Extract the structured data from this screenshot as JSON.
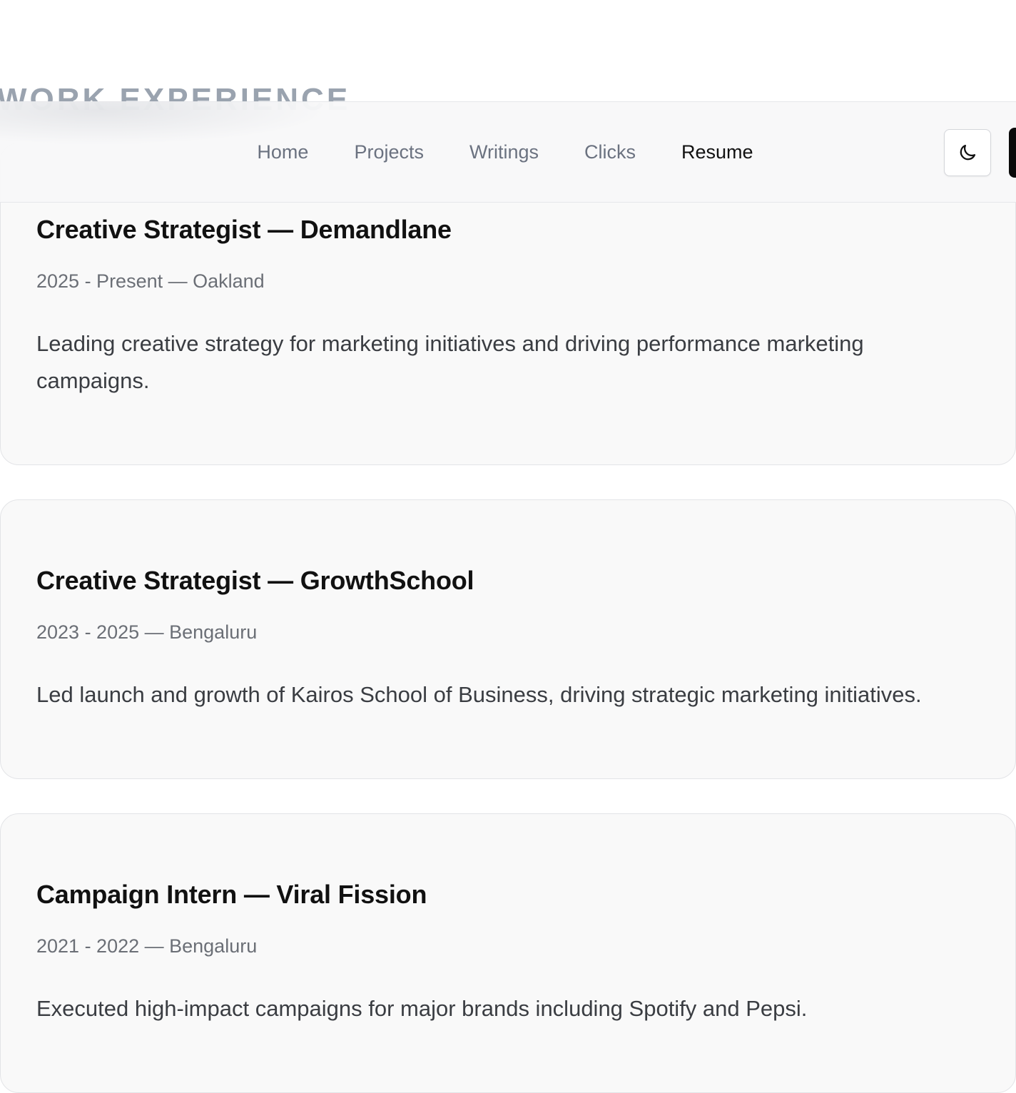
{
  "section": {
    "heading": "WORK EXPERIENCE"
  },
  "nav": {
    "links": [
      {
        "label": "Home"
      },
      {
        "label": "Projects"
      },
      {
        "label": "Writings"
      },
      {
        "label": "Clicks"
      },
      {
        "label": "Resume"
      }
    ],
    "active": "Resume",
    "theme_toggle_icon": "moon-icon"
  },
  "experience": [
    {
      "title": "Creative Strategist — Demandlane",
      "meta": "2025 - Present — Oakland",
      "description": "Leading creative strategy for marketing initiatives and driving performance marketing campaigns."
    },
    {
      "title": "Creative Strategist — GrowthSchool",
      "meta": "2023 - 2025 — Bengaluru",
      "description": "Led launch and growth of Kairos School of Business, driving strategic marketing initiatives."
    },
    {
      "title": "Campaign Intern — Viral Fission",
      "meta": "2021 - 2022 — Bengaluru",
      "description": "Executed high-impact campaigns for major brands including Spotify and Pepsi."
    }
  ],
  "colors": {
    "accent_active": "#111111",
    "nav_inactive": "#6b7280",
    "card_bg": "#f9f9f9",
    "heading_muted": "#9aa3af"
  }
}
